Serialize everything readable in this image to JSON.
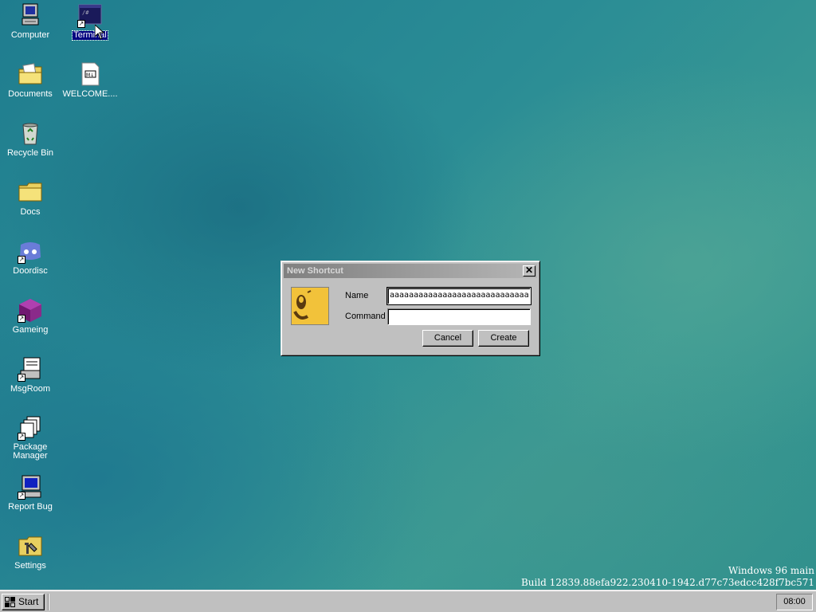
{
  "desktop": {
    "icons": [
      {
        "label": "Computer",
        "icon": "computer-icon"
      },
      {
        "label": "Terminal",
        "icon": "terminal-icon",
        "selected": true
      },
      {
        "label": "Documents",
        "icon": "documents-folder-icon"
      },
      {
        "label": "WELCOME....",
        "icon": "markdown-file-icon"
      },
      {
        "label": "Recycle Bin",
        "icon": "recycle-bin-icon"
      },
      {
        "label": "Docs",
        "icon": "folder-icon"
      },
      {
        "label": "Doordisc",
        "icon": "doordisc-icon"
      },
      {
        "label": "Gameing",
        "icon": "gameing-icon"
      },
      {
        "label": "MsgRoom",
        "icon": "msgroom-icon"
      },
      {
        "label": "Package Manager",
        "icon": "package-manager-icon"
      },
      {
        "label": "Report Bug",
        "icon": "report-bug-icon"
      },
      {
        "label": "Settings",
        "icon": "settings-icon"
      }
    ]
  },
  "dialog": {
    "title": "New Shortcut",
    "close_icon": "close-icon",
    "icon": "shortcut-face-icon",
    "name_label": "Name",
    "name_value": "aaaaaaaaaaaaaaaaaaaaaaaaaaaaa",
    "command_label": "Command",
    "command_value": "",
    "cancel_label": "Cancel",
    "create_label": "Create"
  },
  "build_info": {
    "line1": "Windows 96 main",
    "line2": "Build 12839.88efa922.230410-1942.d77c73edcc428f7bc571"
  },
  "taskbar": {
    "start_label": "Start",
    "start_icon": "windows96-logo-icon",
    "clock": "08:00"
  },
  "colors": {
    "desktop": "#2a8c95",
    "selection": "#000080",
    "chrome": "#c0c0c0"
  }
}
